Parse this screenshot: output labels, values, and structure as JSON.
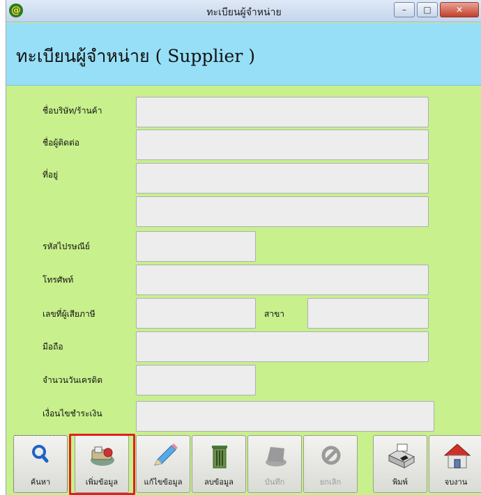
{
  "window": {
    "title": "ทะเบียนผู้จำหน่าย",
    "app_icon": "@",
    "minimize": "–",
    "maximize": "□",
    "close": "✕"
  },
  "header": {
    "title": "ทะเบียนผู้จำหน่าย ( Supplier )"
  },
  "form": {
    "company_label": "ชื่อบริษัท/ร้านค้า",
    "contact_label": "ชื่อผู้ติดต่อ",
    "address_label": "ที่อยู่",
    "postal_label": "รหัสไปรษณีย์",
    "phone_label": "โทรศัพท์",
    "taxid_label": "เลขที่ผู้เสียภาษี",
    "branch_label": "สาขา",
    "mobile_label": "มือถือ",
    "credit_days_label": "จำนวนวันเครดิต",
    "payment_terms_label": "เงื่อนไขชำระเงิน",
    "values": {
      "company": "",
      "contact": "",
      "address1": "",
      "address2": "",
      "postal": "",
      "phone": "",
      "taxid": "",
      "branch": "",
      "mobile": "",
      "credit_days": "",
      "payment_terms": ""
    }
  },
  "toolbar": {
    "search": "ค้นหา",
    "add": "เพิ่มข้อมูล",
    "edit": "แก้ไขข้อมูล",
    "delete": "ลบข้อมูล",
    "save": "บันทึก",
    "cancel": "ยกเลิก",
    "print": "พิมพ์",
    "exit": "จบงาน"
  },
  "colors": {
    "form_bg": "#c8f08c",
    "header_bg": "#97dff6",
    "highlight": "#e0201a"
  },
  "icons": [
    "search-icon",
    "add-record-icon",
    "pencil-icon",
    "trash-icon",
    "save-icon",
    "cancel-icon",
    "printer-icon",
    "house-icon"
  ]
}
